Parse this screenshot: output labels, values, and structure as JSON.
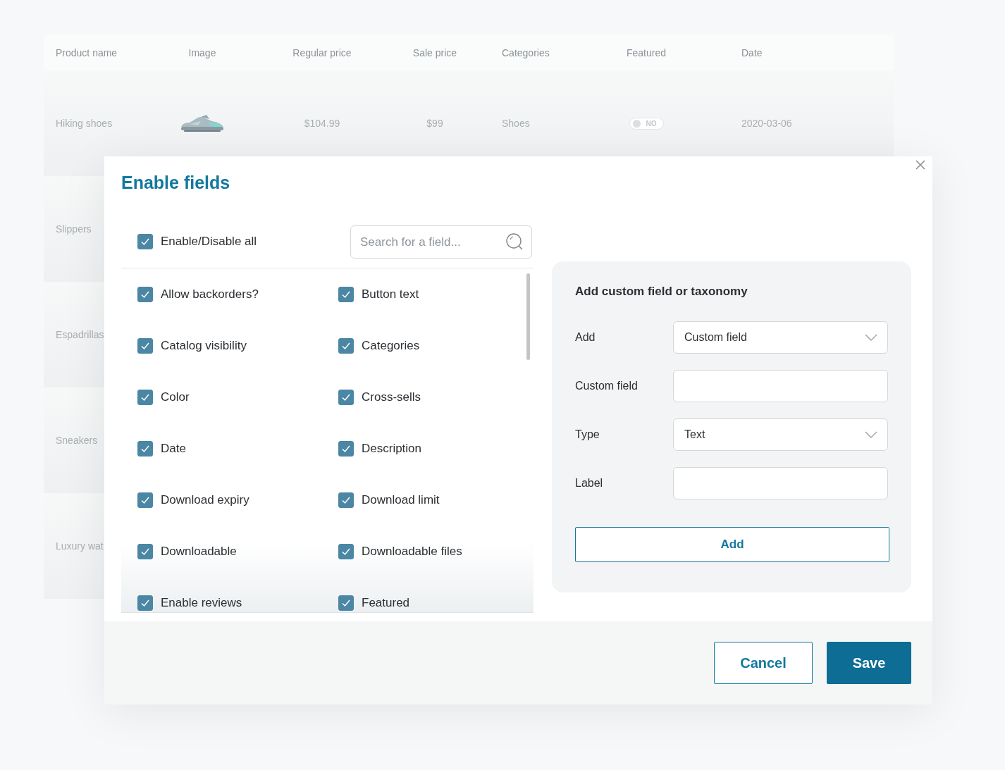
{
  "table": {
    "columns": [
      "Product name",
      "Image",
      "Regular price",
      "Sale price",
      "Categories",
      "Featured",
      "Date"
    ],
    "rows": [
      {
        "product_name": "Hiking shoes",
        "regular_price": "$104.99",
        "sale_price": "$99",
        "categories": "Shoes",
        "featured": {
          "label": "NO",
          "on": false
        },
        "date": "2020-03-06"
      },
      {
        "product_name": "Slippers"
      },
      {
        "product_name": "Espadrillas"
      },
      {
        "product_name": "Sneakers"
      },
      {
        "product_name": "Luxury wat"
      }
    ]
  },
  "dialog": {
    "title": "Enable fields",
    "toggle_all": {
      "label": "Enable/Disable all",
      "checked": true
    },
    "search": {
      "placeholder": "Search for a field..."
    },
    "fields": [
      {
        "label": "Allow backorders?",
        "checked": true
      },
      {
        "label": "Button text",
        "checked": true
      },
      {
        "label": "Catalog visibility",
        "checked": true
      },
      {
        "label": "Categories",
        "checked": true
      },
      {
        "label": "Color",
        "checked": true
      },
      {
        "label": "Cross-sells",
        "checked": true
      },
      {
        "label": "Date",
        "checked": true
      },
      {
        "label": "Description",
        "checked": true
      },
      {
        "label": "Download expiry",
        "checked": true
      },
      {
        "label": "Download limit",
        "checked": true
      },
      {
        "label": "Downloadable",
        "checked": true
      },
      {
        "label": "Downloadable files",
        "checked": true
      },
      {
        "label": "Enable reviews",
        "checked": true
      },
      {
        "label": "Featured",
        "checked": true
      }
    ],
    "custom": {
      "title": "Add custom field or taxonomy",
      "rows": [
        {
          "label": "Add",
          "kind": "select",
          "value": "Custom field"
        },
        {
          "label": "Custom field",
          "kind": "input"
        },
        {
          "label": "Type",
          "kind": "select",
          "value": "Text"
        },
        {
          "label": "Label",
          "kind": "input"
        }
      ],
      "button": "Add"
    },
    "buttons": [
      {
        "label": "Cancel",
        "kind": "secondary"
      },
      {
        "label": "Save",
        "kind": "primary"
      }
    ]
  }
}
